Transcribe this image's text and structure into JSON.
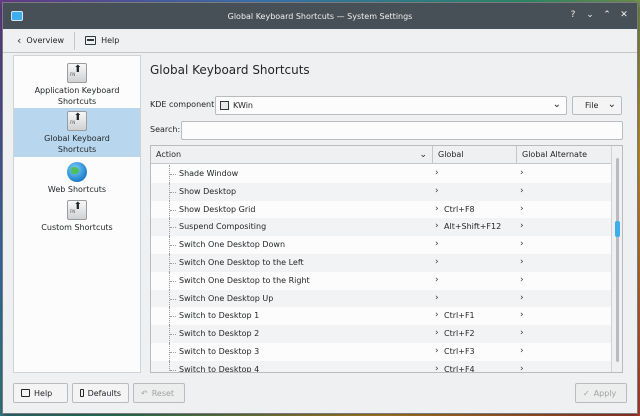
{
  "window": {
    "title": "Global Keyboard Shortcuts — System Settings",
    "controls": [
      "?",
      "⌄",
      "⌃",
      "✕"
    ]
  },
  "toolbar": {
    "overview_label": "Overview",
    "help_label": "Help"
  },
  "sidebar": {
    "items": [
      {
        "label1": "Application Keyboard",
        "label2": "Shortcuts",
        "icon": "keyboard-key-icon"
      },
      {
        "label1": "Global Keyboard",
        "label2": "Shortcuts",
        "icon": "keyboard-key-icon"
      },
      {
        "label1": "Web Shortcuts",
        "label2": "",
        "icon": "globe-icon"
      },
      {
        "label1": "Custom Shortcuts",
        "label2": "",
        "icon": "keyboard-key-icon"
      }
    ],
    "selected_index": 1,
    "key_icon_text": "FN"
  },
  "main": {
    "title": "Global Keyboard Shortcuts",
    "kde_component_label": "KDE component:",
    "kde_component_value": "KWin",
    "file_label": "File",
    "search_label": "Search:",
    "search_value": ""
  },
  "table": {
    "headers": [
      "Action",
      "Global",
      "Global Alternate"
    ],
    "rows": [
      {
        "action": "Shade Window",
        "global": "",
        "alt": ""
      },
      {
        "action": "Show Desktop",
        "global": "",
        "alt": ""
      },
      {
        "action": "Show Desktop Grid",
        "global": "Ctrl+F8",
        "alt": ""
      },
      {
        "action": "Suspend Compositing",
        "global": "Alt+Shift+F12",
        "alt": ""
      },
      {
        "action": "Switch One Desktop Down",
        "global": "",
        "alt": ""
      },
      {
        "action": "Switch One Desktop to the Left",
        "global": "",
        "alt": ""
      },
      {
        "action": "Switch One Desktop to the Right",
        "global": "",
        "alt": ""
      },
      {
        "action": "Switch One Desktop Up",
        "global": "",
        "alt": ""
      },
      {
        "action": "Switch to Desktop 1",
        "global": "Ctrl+F1",
        "alt": ""
      },
      {
        "action": "Switch to Desktop 2",
        "global": "Ctrl+F2",
        "alt": ""
      },
      {
        "action": "Switch to Desktop 3",
        "global": "Ctrl+F3",
        "alt": ""
      },
      {
        "action": "Switch to Desktop 4",
        "global": "Ctrl+F4",
        "alt": ""
      }
    ],
    "expand_glyph": "›"
  },
  "buttons": {
    "help": "Help",
    "defaults": "Defaults",
    "reset": "Reset",
    "apply": "Apply"
  },
  "colors": {
    "accent": "#3daee9",
    "selection": "#b8d7ef",
    "titlebar": "#475057"
  }
}
